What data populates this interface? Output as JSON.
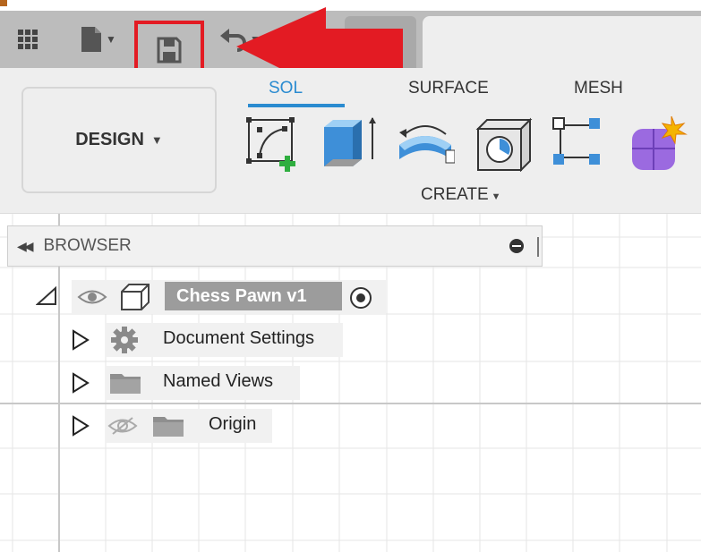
{
  "toolbar": {
    "grid_icon": "grid-icon",
    "file_icon": "file-icon",
    "save_icon": "save-icon",
    "undo_icon": "undo-icon",
    "highlight_color": "#e31b23"
  },
  "ribbon": {
    "workspace_label": "DESIGN",
    "tabs": [
      {
        "label": "SOLID",
        "visible_text": "SOL"
      },
      {
        "label": "SURFACE"
      },
      {
        "label": "MESH"
      }
    ],
    "tools": [
      "create-sketch-icon",
      "extrude-icon",
      "revolve-icon",
      "hole-icon",
      "pattern-icon",
      "create-form-icon"
    ],
    "create_label": "CREATE",
    "accent_color": "#2a8bd0"
  },
  "browser": {
    "title": "BROWSER",
    "root": {
      "label": "Chess Pawn v1"
    },
    "items": [
      {
        "label": "Document Settings",
        "icon": "gear-icon"
      },
      {
        "label": "Named Views",
        "icon": "folder-icon"
      },
      {
        "label": "Origin",
        "icon": "folder-icon",
        "visibility": "hidden-eye-icon"
      }
    ]
  }
}
